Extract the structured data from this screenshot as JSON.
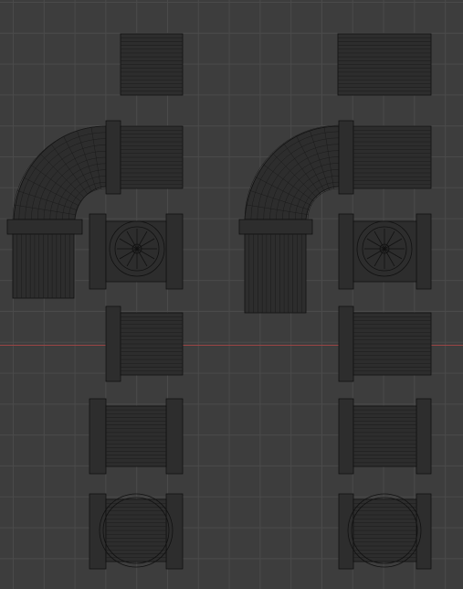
{
  "viewport": {
    "background_color": "#3d3d3d",
    "grid_color": "#4a4a4a",
    "x_axis_color": "#9a4545",
    "wire_color": "#111111"
  },
  "objects": [
    {
      "group": "left",
      "kind": "pipe-straight-top"
    },
    {
      "group": "left",
      "kind": "pipe-elbow"
    },
    {
      "group": "left",
      "kind": "pipe-cross-fan"
    },
    {
      "group": "left",
      "kind": "pipe-flanged-single"
    },
    {
      "group": "left",
      "kind": "pipe-flanged-double"
    },
    {
      "group": "left",
      "kind": "pipe-flanged-circle"
    },
    {
      "group": "right",
      "kind": "pipe-straight-top"
    },
    {
      "group": "right",
      "kind": "pipe-elbow"
    },
    {
      "group": "right",
      "kind": "pipe-cross-fan"
    },
    {
      "group": "right",
      "kind": "pipe-flanged-single"
    },
    {
      "group": "right",
      "kind": "pipe-flanged-double"
    },
    {
      "group": "right",
      "kind": "pipe-flanged-circle"
    }
  ]
}
